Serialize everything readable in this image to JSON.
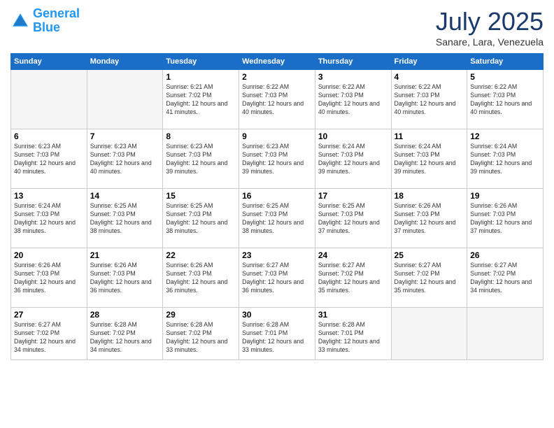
{
  "logo": {
    "line1": "General",
    "line2": "Blue"
  },
  "title": "July 2025",
  "subtitle": "Sanare, Lara, Venezuela",
  "days_header": [
    "Sunday",
    "Monday",
    "Tuesday",
    "Wednesday",
    "Thursday",
    "Friday",
    "Saturday"
  ],
  "weeks": [
    [
      {
        "day": "",
        "info": ""
      },
      {
        "day": "",
        "info": ""
      },
      {
        "day": "1",
        "info": "Sunrise: 6:21 AM\nSunset: 7:02 PM\nDaylight: 12 hours and 41 minutes."
      },
      {
        "day": "2",
        "info": "Sunrise: 6:22 AM\nSunset: 7:03 PM\nDaylight: 12 hours and 40 minutes."
      },
      {
        "day": "3",
        "info": "Sunrise: 6:22 AM\nSunset: 7:03 PM\nDaylight: 12 hours and 40 minutes."
      },
      {
        "day": "4",
        "info": "Sunrise: 6:22 AM\nSunset: 7:03 PM\nDaylight: 12 hours and 40 minutes."
      },
      {
        "day": "5",
        "info": "Sunrise: 6:22 AM\nSunset: 7:03 PM\nDaylight: 12 hours and 40 minutes."
      }
    ],
    [
      {
        "day": "6",
        "info": "Sunrise: 6:23 AM\nSunset: 7:03 PM\nDaylight: 12 hours and 40 minutes."
      },
      {
        "day": "7",
        "info": "Sunrise: 6:23 AM\nSunset: 7:03 PM\nDaylight: 12 hours and 40 minutes."
      },
      {
        "day": "8",
        "info": "Sunrise: 6:23 AM\nSunset: 7:03 PM\nDaylight: 12 hours and 39 minutes."
      },
      {
        "day": "9",
        "info": "Sunrise: 6:23 AM\nSunset: 7:03 PM\nDaylight: 12 hours and 39 minutes."
      },
      {
        "day": "10",
        "info": "Sunrise: 6:24 AM\nSunset: 7:03 PM\nDaylight: 12 hours and 39 minutes."
      },
      {
        "day": "11",
        "info": "Sunrise: 6:24 AM\nSunset: 7:03 PM\nDaylight: 12 hours and 39 minutes."
      },
      {
        "day": "12",
        "info": "Sunrise: 6:24 AM\nSunset: 7:03 PM\nDaylight: 12 hours and 39 minutes."
      }
    ],
    [
      {
        "day": "13",
        "info": "Sunrise: 6:24 AM\nSunset: 7:03 PM\nDaylight: 12 hours and 38 minutes."
      },
      {
        "day": "14",
        "info": "Sunrise: 6:25 AM\nSunset: 7:03 PM\nDaylight: 12 hours and 38 minutes."
      },
      {
        "day": "15",
        "info": "Sunrise: 6:25 AM\nSunset: 7:03 PM\nDaylight: 12 hours and 38 minutes."
      },
      {
        "day": "16",
        "info": "Sunrise: 6:25 AM\nSunset: 7:03 PM\nDaylight: 12 hours and 38 minutes."
      },
      {
        "day": "17",
        "info": "Sunrise: 6:25 AM\nSunset: 7:03 PM\nDaylight: 12 hours and 37 minutes."
      },
      {
        "day": "18",
        "info": "Sunrise: 6:26 AM\nSunset: 7:03 PM\nDaylight: 12 hours and 37 minutes."
      },
      {
        "day": "19",
        "info": "Sunrise: 6:26 AM\nSunset: 7:03 PM\nDaylight: 12 hours and 37 minutes."
      }
    ],
    [
      {
        "day": "20",
        "info": "Sunrise: 6:26 AM\nSunset: 7:03 PM\nDaylight: 12 hours and 36 minutes."
      },
      {
        "day": "21",
        "info": "Sunrise: 6:26 AM\nSunset: 7:03 PM\nDaylight: 12 hours and 36 minutes."
      },
      {
        "day": "22",
        "info": "Sunrise: 6:26 AM\nSunset: 7:03 PM\nDaylight: 12 hours and 36 minutes."
      },
      {
        "day": "23",
        "info": "Sunrise: 6:27 AM\nSunset: 7:03 PM\nDaylight: 12 hours and 36 minutes."
      },
      {
        "day": "24",
        "info": "Sunrise: 6:27 AM\nSunset: 7:02 PM\nDaylight: 12 hours and 35 minutes."
      },
      {
        "day": "25",
        "info": "Sunrise: 6:27 AM\nSunset: 7:02 PM\nDaylight: 12 hours and 35 minutes."
      },
      {
        "day": "26",
        "info": "Sunrise: 6:27 AM\nSunset: 7:02 PM\nDaylight: 12 hours and 34 minutes."
      }
    ],
    [
      {
        "day": "27",
        "info": "Sunrise: 6:27 AM\nSunset: 7:02 PM\nDaylight: 12 hours and 34 minutes."
      },
      {
        "day": "28",
        "info": "Sunrise: 6:28 AM\nSunset: 7:02 PM\nDaylight: 12 hours and 34 minutes."
      },
      {
        "day": "29",
        "info": "Sunrise: 6:28 AM\nSunset: 7:02 PM\nDaylight: 12 hours and 33 minutes."
      },
      {
        "day": "30",
        "info": "Sunrise: 6:28 AM\nSunset: 7:01 PM\nDaylight: 12 hours and 33 minutes."
      },
      {
        "day": "31",
        "info": "Sunrise: 6:28 AM\nSunset: 7:01 PM\nDaylight: 12 hours and 33 minutes."
      },
      {
        "day": "",
        "info": ""
      },
      {
        "day": "",
        "info": ""
      }
    ]
  ]
}
